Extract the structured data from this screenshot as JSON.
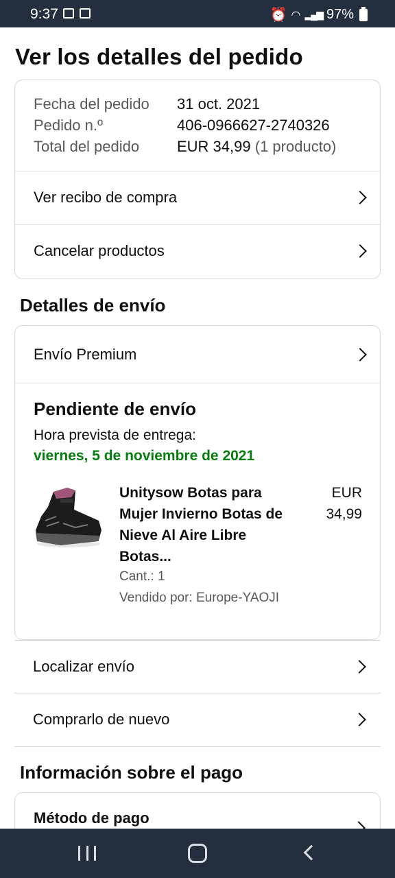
{
  "status_bar": {
    "time": "9:37",
    "battery": "97%"
  },
  "page": {
    "title": "Ver los detalles del pedido"
  },
  "order_summary": {
    "date_label": "Fecha del pedido",
    "date_value": "31 oct. 2021",
    "number_label": "Pedido n.º",
    "number_value": "406-0966627-2740326",
    "total_label": "Total del pedido",
    "total_value": "EUR 34,99",
    "total_count": "(1 producto)",
    "receipt_link": "Ver recibo de compra",
    "cancel_link": "Cancelar productos"
  },
  "shipping": {
    "section_title": "Detalles de envío",
    "speed": "Envío Premium",
    "status": "Pendiente de envío",
    "eta_label": "Hora prevista de entrega:",
    "eta_date": "viernes, 5 de noviembre de 2021",
    "product": {
      "title": "Unitysow Botas para Mujer Invierno Botas de Nieve Al Aire Libre Botas...",
      "price_currency": "EUR",
      "price_amount": "34,99",
      "qty": "Cant.: 1",
      "seller": "Vendido por: Europe-YAOJI"
    },
    "track_link": "Localizar envío",
    "buy_again_link": "Comprarlo de nuevo"
  },
  "payment": {
    "section_title": "Información sobre el pago",
    "method_label": "Método de pago"
  },
  "colors": {
    "header_bg": "#232f3e",
    "delivery_green": "#067d0f",
    "muted_text": "#565959"
  }
}
